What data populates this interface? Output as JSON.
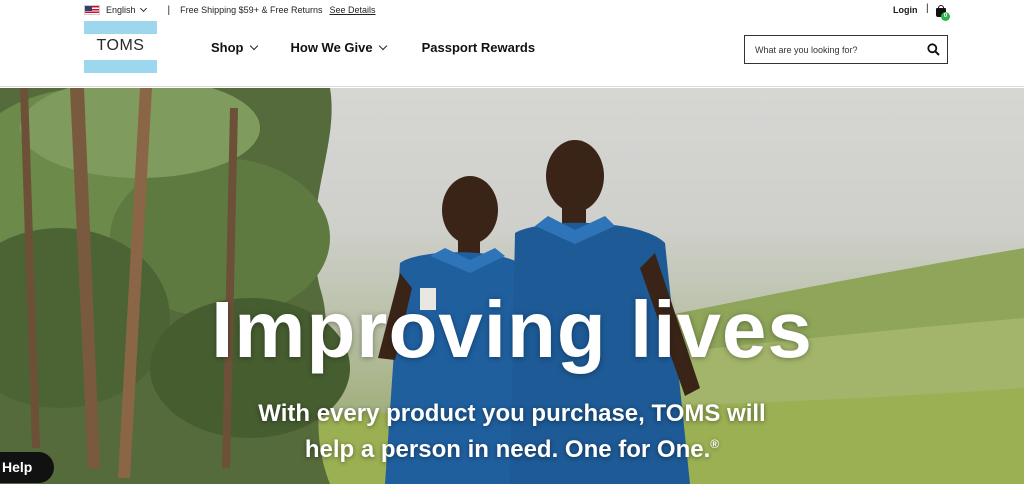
{
  "topbar": {
    "language": "English",
    "shipping": "Free Shipping $59+ & Free Returns",
    "see_details": "See Details"
  },
  "logo": {
    "text": "TOMS"
  },
  "nav": {
    "items": [
      {
        "label": "Shop",
        "dropdown": true
      },
      {
        "label": "How We Give",
        "dropdown": true
      },
      {
        "label": "Passport Rewards",
        "dropdown": false
      }
    ]
  },
  "account": {
    "login": "Login",
    "cart_count": "0"
  },
  "search": {
    "placeholder": "What are you looking for?"
  },
  "hero": {
    "title": "Improving lives",
    "subtitle_line1": "With every product you purchase, TOMS will",
    "subtitle_line2": "help a person in need. One for One.",
    "registered": "®"
  },
  "help": {
    "label": "Help"
  },
  "icons": [
    "us-flag-icon",
    "chevron-down-icon",
    "cart-icon",
    "search-icon"
  ],
  "colors": {
    "logo_blue": "#9dd7ee",
    "cart_badge": "#2fb24c",
    "uniform_blue": "#1f5f9e"
  }
}
